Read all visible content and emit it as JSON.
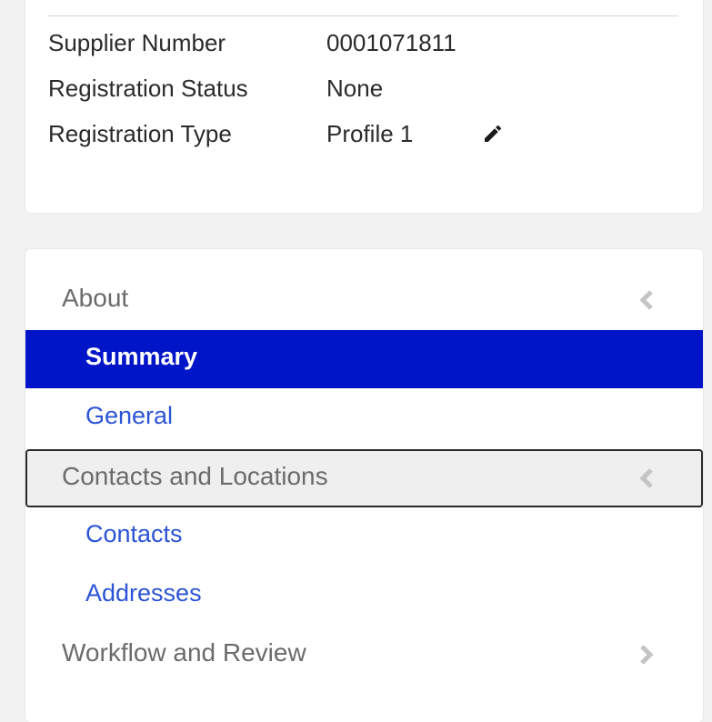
{
  "supplier_info": {
    "rows": [
      {
        "label": "Supplier Number",
        "value": "0001071811"
      },
      {
        "label": "Registration Status",
        "value": "None"
      },
      {
        "label": "Registration Type",
        "value": "Profile 1"
      }
    ],
    "edit_icon": "pencil-icon"
  },
  "nav": {
    "sections": [
      {
        "label": "About",
        "state": "expanded",
        "icon": "chevron-left-icon",
        "items": [
          {
            "label": "Summary",
            "selected": true
          },
          {
            "label": "General",
            "selected": false
          }
        ]
      },
      {
        "label": "Contacts and Locations",
        "state": "expanded",
        "focused": true,
        "icon": "chevron-left-icon",
        "items": [
          {
            "label": "Contacts",
            "selected": false
          },
          {
            "label": "Addresses",
            "selected": false
          }
        ]
      },
      {
        "label": "Workflow and Review",
        "state": "collapsed",
        "icon": "chevron-right-icon",
        "items": []
      }
    ]
  },
  "colors": {
    "selected_bg": "#0014c8",
    "link_text": "#2c54d6",
    "section_text": "#6b6b6b",
    "page_bg": "#f2f2f2"
  }
}
